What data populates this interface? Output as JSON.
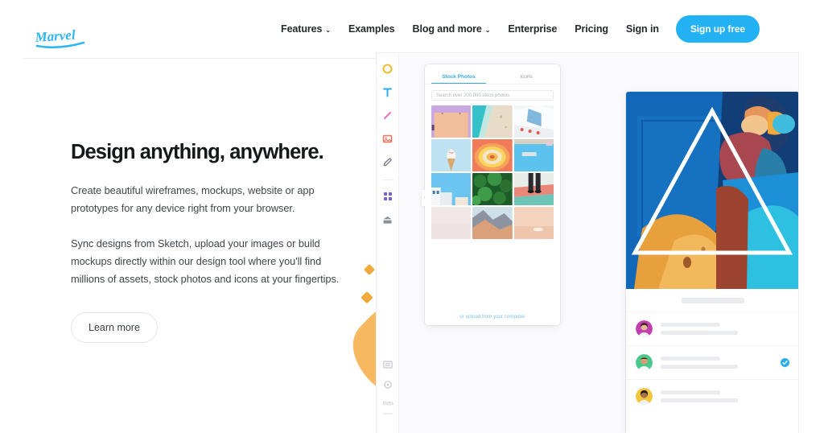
{
  "brand": {
    "logo_text": "Marvel",
    "logo_color": "#2FB5F3"
  },
  "header": {
    "nav": [
      {
        "label": "Features",
        "has_caret": true,
        "caret": "⌄"
      },
      {
        "label": "Examples",
        "has_caret": false,
        "caret": ""
      },
      {
        "label": "Blog and more",
        "has_caret": true,
        "caret": "⌄"
      },
      {
        "label": "Enterprise",
        "has_caret": false,
        "caret": ""
      },
      {
        "label": "Pricing",
        "has_caret": false,
        "caret": ""
      },
      {
        "label": "Sign in",
        "has_caret": false,
        "caret": ""
      }
    ],
    "signup_label": "Sign up free",
    "signup_color": "#22B1F2"
  },
  "hero": {
    "title": "Design anything, anywhere.",
    "paragraph1": "Create beautiful wireframes, mockups, website or app prototypes for any device right from your browser.",
    "paragraph2": "Sync designs from Sketch, upload your images or build mockups directly within our design tool where you'll find millions of assets, stock photos and icons at your fingertips.",
    "cta_label": "Learn more"
  },
  "app": {
    "toolbar": {
      "tools": [
        {
          "name": "shape-circle-icon",
          "color": "#F2B518"
        },
        {
          "name": "text-tool-icon",
          "color": "#2BADF0"
        },
        {
          "name": "pen-stroke-icon",
          "color": "#E86FC0"
        },
        {
          "name": "image-tool-icon",
          "color": "#F2725B"
        },
        {
          "name": "pencil-icon",
          "color": "#767B84"
        },
        {
          "name": "grid-tool-icon",
          "color": "#7B5CE0"
        },
        {
          "name": "box-tool-icon",
          "color": "#8A9099"
        }
      ],
      "bottom_tools": [
        {
          "name": "layers-icon",
          "color": "#C4C8CE"
        },
        {
          "name": "zoom-dial-icon",
          "color": "#C4C8CE"
        }
      ],
      "zoom_level": "100%"
    },
    "panel": {
      "tabs": [
        {
          "label": "Stock Photos",
          "active": true
        },
        {
          "label": "Icons",
          "active": false
        }
      ],
      "search_placeholder": "Search over 200,000 stock photos",
      "upload_label": "or upload from your computer",
      "collapse_glyph": "‹",
      "photos": [
        {
          "name": "poster-lavender-peach"
        },
        {
          "name": "beach-aerial-turquoise"
        },
        {
          "name": "white-boat-deck"
        },
        {
          "name": "ice-cream-cone-blue-sky"
        },
        {
          "name": "rainbow-concentric-rings"
        },
        {
          "name": "blue-door-mailbox"
        },
        {
          "name": "white-buildings-blue-sky"
        },
        {
          "name": "green-foliage-leaves"
        },
        {
          "name": "legs-pink-teal-court"
        },
        {
          "name": "pale-pink-gradient"
        },
        {
          "name": "canyon-rocks"
        },
        {
          "name": "peach-minimal-scene"
        }
      ]
    },
    "artboard": {
      "artwork_name": "blue-mural-figure-artwork",
      "overlay_shape": "triangle-outline",
      "comments": [
        {
          "avatar_name": "avatar-woman-magenta",
          "verified": false
        },
        {
          "avatar_name": "avatar-man-green",
          "verified": true
        },
        {
          "avatar_name": "avatar-woman-yellow",
          "verified": false
        }
      ]
    }
  },
  "decor": {
    "blob_color": "#F5B556",
    "sparkle_color": "#F0A93C"
  }
}
